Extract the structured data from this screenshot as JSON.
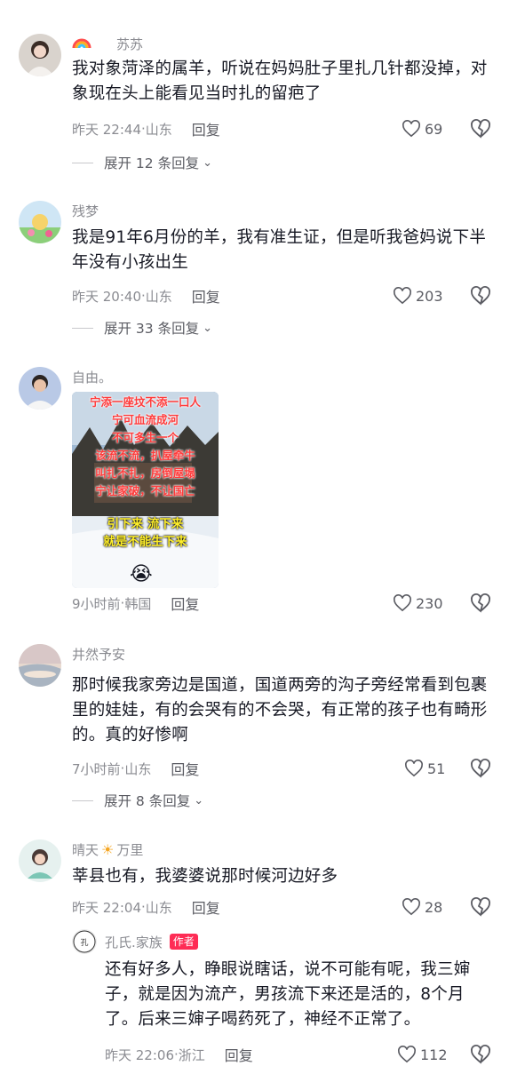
{
  "comments": [
    {
      "username": "苏苏",
      "text": "我对象菏泽的属羊，听说在妈妈肚子里扎几针都没掉，对象现在头上能看见当时扎的留疤了",
      "time": "昨天 22:44",
      "location": "山东",
      "reply": "回复",
      "likes": "69",
      "expand": "展开 12 条回复"
    },
    {
      "username": "残梦",
      "text": "我是91年6月份的羊，我有准生证，但是听我爸妈说下半年没有小孩出生",
      "time": "昨天 20:40",
      "location": "山东",
      "reply": "回复",
      "likes": "203",
      "expand": "展开 33 条回复"
    },
    {
      "username": "自由。",
      "image_text": {
        "red_lines": [
          "宁添一座坟不添一口人",
          "宁可血流成河",
          "不可多生一个",
          "该流不流，扒屋牵牛",
          "叫扎不扎，房倒屋塌",
          "宁让家破，不让国亡"
        ],
        "yellow_lines": [
          "引下来 流下来",
          "就是不能生下来"
        ],
        "emoji": "😭"
      },
      "time": "9小时前",
      "location": "韩国",
      "reply": "回复",
      "likes": "230"
    },
    {
      "username": "井然予安",
      "text": "那时候我家旁边是国道，国道两旁的沟子旁经常看到包裹里的娃娃，有的会哭有的不会哭，有正常的孩子也有畸形的。真的好惨啊",
      "time": "7小时前",
      "location": "山东",
      "reply": "回复",
      "likes": "51",
      "expand": "展开 8 条回复"
    },
    {
      "username_a": "晴天",
      "username_b": "万里",
      "text": "莘县也有，我婆婆说那时候河边好多",
      "time": "昨天 22:04",
      "location": "山东",
      "reply": "回复",
      "likes": "28"
    }
  ],
  "reply": {
    "username": "孔氏.家族",
    "badge": "作者",
    "text": "还有好多人，睁眼说瞎话，说不可能有呢，我三婶子，就是因为流产，男孩流下来还是活的，8个月了。后来三婶子喝药死了，神经不正常了。",
    "time": "昨天 22:06",
    "location": "浙江",
    "reply": "回复",
    "likes": "112"
  },
  "icons": {
    "like": "heart-outline-icon",
    "dislike": "broken-heart-icon",
    "expand": "chevron-down-icon",
    "sun": "sun-emoji-icon",
    "rainbow": "rainbow-emoji-icon"
  },
  "colors": {
    "primary_text": "#161823",
    "secondary_text": "#8a8b91",
    "author_badge": "#fe2c55"
  }
}
